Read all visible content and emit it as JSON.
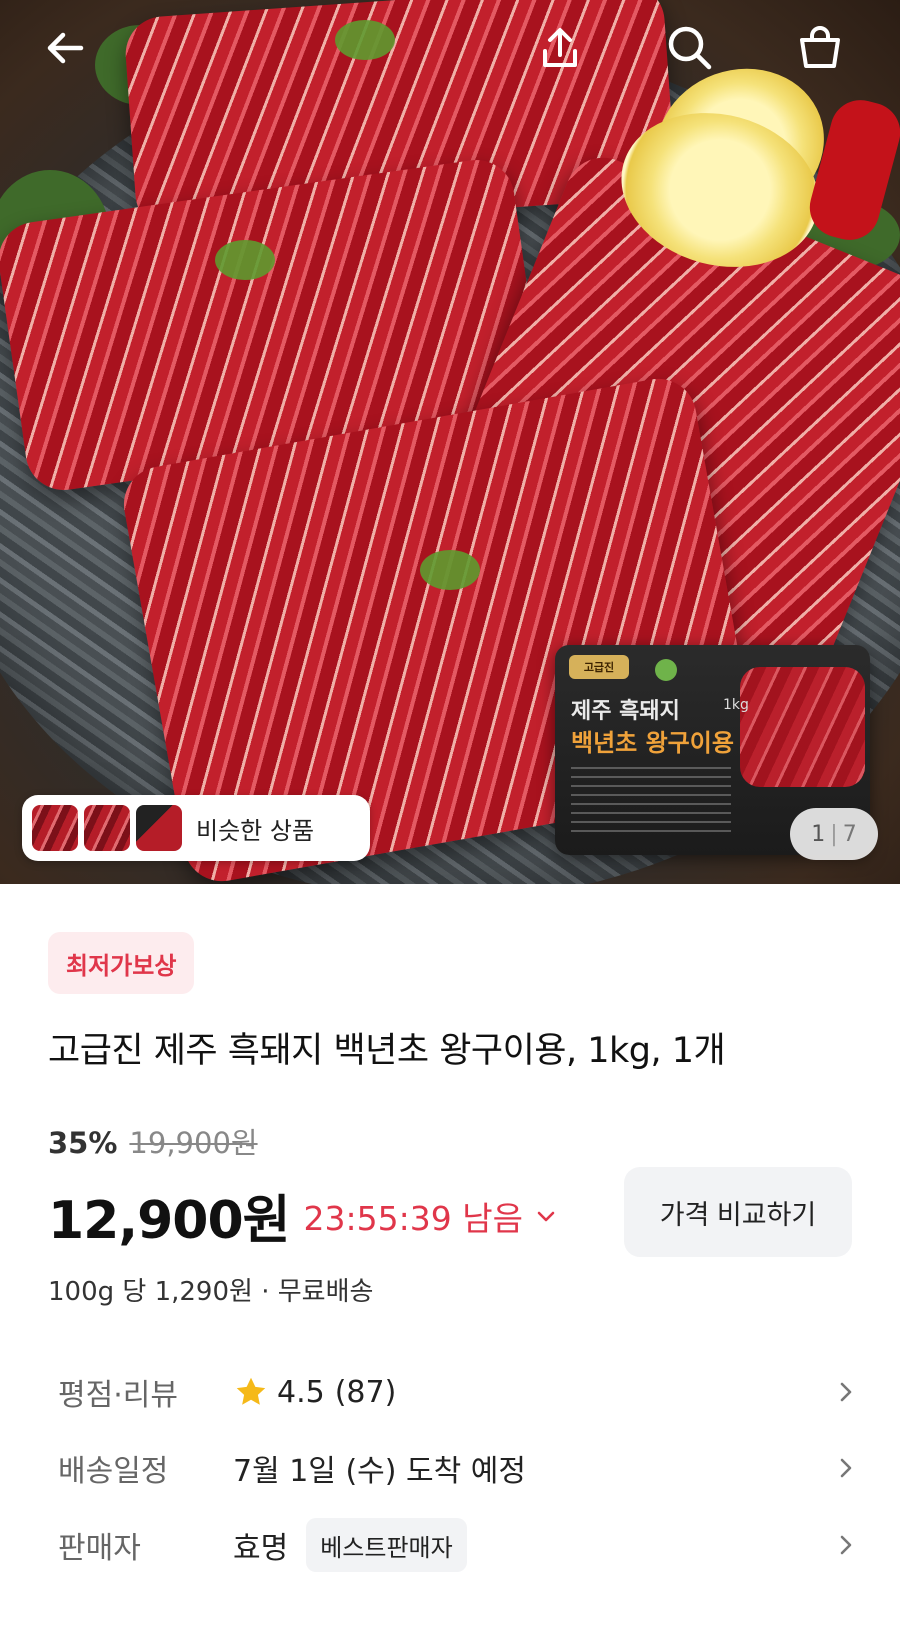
{
  "gallery": {
    "similar_label": "비슷한 상품",
    "current_index": "1",
    "total": "7",
    "package": {
      "brand": "고급진",
      "line1": "제주 흑돼지",
      "weight": "1kg",
      "line2": "백년초 왕구이용"
    }
  },
  "topbar": {
    "icons": [
      "back-arrow-icon",
      "share-icon",
      "search-icon",
      "cart-icon"
    ]
  },
  "product": {
    "badge": "최저가보상",
    "title": "고급진 제주 흑돼지 백년초 왕구이용, 1kg, 1개",
    "discount": "35%",
    "original_price": "19,900원",
    "price": "12,900원",
    "timer": "23:55:39 남음",
    "compare_label": "가격 비교하기",
    "unit_price": "100g 당 1,290원 · 무료배송"
  },
  "info": {
    "rating_label": "평점·리뷰",
    "rating_value": "4.5",
    "review_count": "(87)",
    "delivery_label": "배송일정",
    "delivery_value": "7월 1일 (수) 도착 예정",
    "seller_label": "판매자",
    "seller_value": "효명",
    "seller_badge": "베스트판매자"
  },
  "colors": {
    "accent_red": "#e0364a",
    "badge_bg": "#fdecee",
    "star": "#f5b919",
    "button_bg": "#f2f3f5"
  }
}
